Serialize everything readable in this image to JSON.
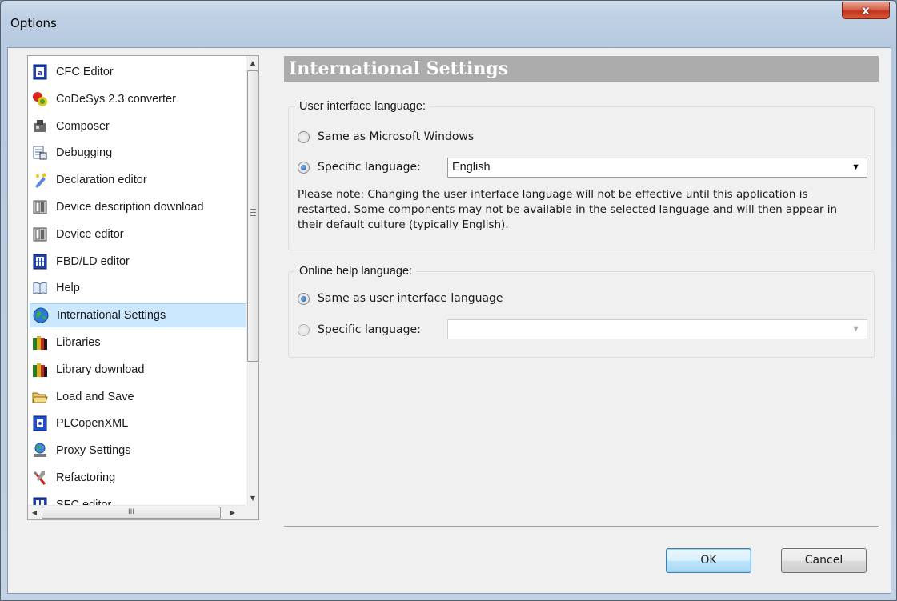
{
  "window": {
    "title": "Options",
    "close_label": "x"
  },
  "tree": {
    "items": [
      {
        "label": "CFC Editor",
        "icon": "cfc-editor-icon",
        "selected": false
      },
      {
        "label": "CoDeSys 2.3 converter",
        "icon": "converter-icon",
        "selected": false
      },
      {
        "label": "Composer",
        "icon": "composer-icon",
        "selected": false
      },
      {
        "label": "Debugging",
        "icon": "debugging-icon",
        "selected": false
      },
      {
        "label": "Declaration editor",
        "icon": "declaration-editor-icon",
        "selected": false
      },
      {
        "label": "Device description download",
        "icon": "device-download-icon",
        "selected": false
      },
      {
        "label": "Device editor",
        "icon": "device-editor-icon",
        "selected": false
      },
      {
        "label": "FBD/LD editor",
        "icon": "fbd-ld-editor-icon",
        "selected": false
      },
      {
        "label": "Help",
        "icon": "help-book-icon",
        "selected": false
      },
      {
        "label": "International Settings",
        "icon": "globe-icon",
        "selected": true
      },
      {
        "label": "Libraries",
        "icon": "libraries-icon",
        "selected": false
      },
      {
        "label": "Library download",
        "icon": "library-download-icon",
        "selected": false
      },
      {
        "label": "Load and Save",
        "icon": "folder-open-icon",
        "selected": false
      },
      {
        "label": "PLCopenXML",
        "icon": "plcopenxml-icon",
        "selected": false
      },
      {
        "label": "Proxy Settings",
        "icon": "proxy-icon",
        "selected": false
      },
      {
        "label": "Refactoring",
        "icon": "refactoring-icon",
        "selected": false
      },
      {
        "label": "SFC editor",
        "icon": "sfc-editor-icon",
        "selected": false
      }
    ],
    "hscroll_grip": "III"
  },
  "panel": {
    "title": "International Settings",
    "ui_language": {
      "group_title": "User interface language:",
      "option_windows": "Same as Microsoft Windows",
      "option_specific": "Specific language:",
      "selected_language": "English",
      "selected_option": "specific",
      "note": "Please note: Changing the user interface language will not be effective until this application is restarted. Some components may not be available in the selected language and will then appear in their default culture (typically English)."
    },
    "help_language": {
      "group_title": "Online help language:",
      "option_same": "Same as user interface language",
      "option_specific": "Specific language:",
      "selected_language": "",
      "selected_option": "same"
    }
  },
  "buttons": {
    "ok": "OK",
    "cancel": "Cancel"
  }
}
